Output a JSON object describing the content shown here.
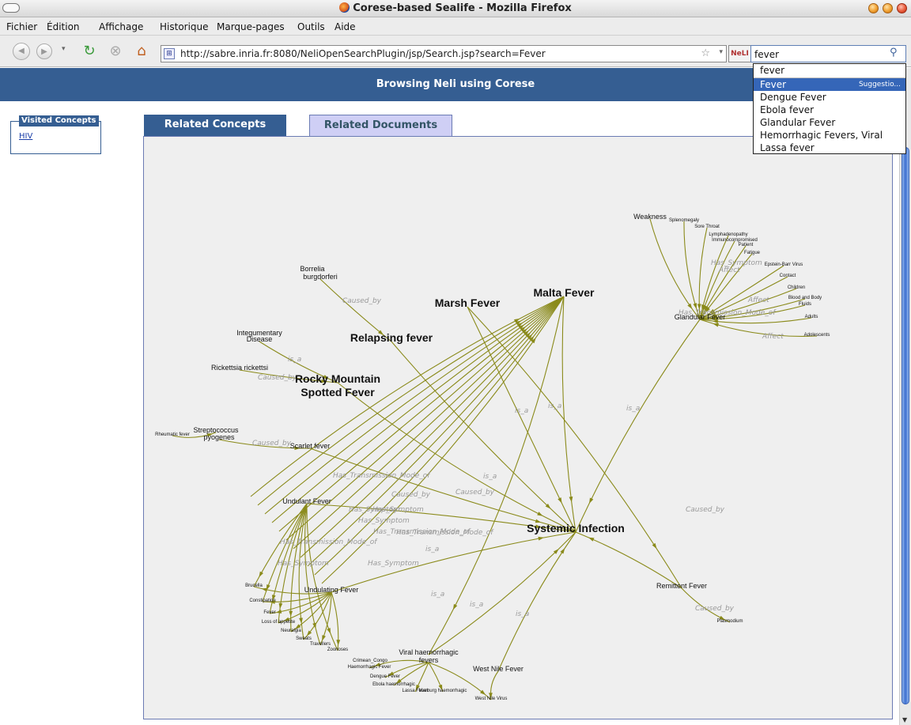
{
  "window": {
    "title": "Corese-based Sealife - Mozilla Firefox"
  },
  "menubar": {
    "items": [
      "Fichier",
      "Édition",
      "Affichage",
      "Historique",
      "Marque-pages",
      "Outils",
      "Aide"
    ]
  },
  "navbar": {
    "url": "http://sabre.inria.fr:8080/NeliOpenSearchPlugin/jsp/Search.jsp?search=Fever",
    "search_value": "fever",
    "search_engine_label": "NeLI"
  },
  "header": {
    "title": "Browsing Neli using Corese"
  },
  "sidebar": {
    "visited_title": "Visited Concepts",
    "visited_links": [
      "HIV"
    ]
  },
  "tabs": [
    {
      "label": "Related Concepts",
      "active": true
    },
    {
      "label": "Related Documents",
      "active": false
    }
  ],
  "suggestions": {
    "typed": "fever",
    "items": [
      "Fever",
      "Dengue Fever",
      "Ebola fever",
      "Glandular Fever",
      "Hemorrhagic Fevers, Viral",
      "Lassa fever"
    ],
    "selected_index": 0,
    "selected_hint": "Suggestio..."
  },
  "graph": {
    "edge_color": "#8a8a1a",
    "nodes": [
      {
        "id": "systemic",
        "label": "Systemic Infection",
        "size": "large"
      },
      {
        "id": "malta",
        "label": "Malta Fever",
        "size": "large"
      },
      {
        "id": "marsh",
        "label": "Marsh Fever",
        "size": "large"
      },
      {
        "id": "relapsing",
        "label": "Relapsing fever",
        "size": "large"
      },
      {
        "id": "rocky",
        "label": "Rocky Mountain",
        "size": "large"
      },
      {
        "id": "spotted",
        "label": "Spotted Fever",
        "size": "large"
      },
      {
        "id": "undulant",
        "label": "Undulant Fever",
        "size": "small"
      },
      {
        "id": "undulating",
        "label": "Undulating Fever",
        "size": "small"
      },
      {
        "id": "scarlet",
        "label": "Scarlet fever",
        "size": "small"
      },
      {
        "id": "borrelia1",
        "label": "Borrelia",
        "size": "small"
      },
      {
        "id": "borrelia2",
        "label": "burgdorferi",
        "size": "small"
      },
      {
        "id": "integ1",
        "label": "Integumentary",
        "size": "small"
      },
      {
        "id": "integ2",
        "label": "Disease",
        "size": "small"
      },
      {
        "id": "rickettsia",
        "label": "Rickettsia rickettsi",
        "size": "small"
      },
      {
        "id": "strep1",
        "label": "Streptococcus",
        "size": "small"
      },
      {
        "id": "strep2",
        "label": "pyogenes",
        "size": "small"
      },
      {
        "id": "rheum",
        "label": "Rheumatic fever",
        "size": "tiny"
      },
      {
        "id": "glandular",
        "label": "Glandular Fever",
        "size": "small"
      },
      {
        "id": "weakness",
        "label": "Weakness",
        "size": "small"
      },
      {
        "id": "remittent",
        "label": "Remittent Fever",
        "size": "small"
      },
      {
        "id": "plasmodium",
        "label": "Plasmodium",
        "size": "tiny"
      },
      {
        "id": "viral1",
        "label": "Viral haemorrhagic",
        "size": "small"
      },
      {
        "id": "viral2",
        "label": "fevers",
        "size": "small"
      },
      {
        "id": "westnile",
        "label": "West Nile Fever",
        "size": "small"
      },
      {
        "id": "westnilevirus",
        "label": "West Nile Virus",
        "size": "tiny"
      },
      {
        "id": "crimean1",
        "label": "Crimean_Congo",
        "size": "tiny"
      },
      {
        "id": "crimean2",
        "label": "Haemorrhagic Fever",
        "size": "tiny"
      },
      {
        "id": "dengue",
        "label": "Dengue Fever",
        "size": "tiny"
      },
      {
        "id": "ebola",
        "label": "Ebola haemorrhagic",
        "size": "tiny"
      },
      {
        "id": "lassa",
        "label": "Lassa Fever",
        "size": "tiny"
      },
      {
        "id": "marburg",
        "label": "Marburg haemorrhagic",
        "size": "tiny"
      },
      {
        "id": "brucella",
        "label": "Brucella",
        "size": "tiny"
      },
      {
        "id": "constipation",
        "label": "Constipation",
        "size": "tiny"
      },
      {
        "id": "fever",
        "label": "Fever",
        "size": "tiny"
      },
      {
        "id": "lossapp",
        "label": "Loss of appetite",
        "size": "tiny"
      },
      {
        "id": "neuralgia",
        "label": "Neuralgia",
        "size": "tiny"
      },
      {
        "id": "sweats",
        "label": "Sweats",
        "size": "tiny"
      },
      {
        "id": "travellers",
        "label": "Travellers",
        "size": "tiny"
      },
      {
        "id": "zoonoses",
        "label": "Zoonoses",
        "size": "tiny"
      },
      {
        "id": "splenomegaly",
        "label": "Splenomegaly",
        "size": "tiny"
      },
      {
        "id": "sorethroat",
        "label": "Sore Throat",
        "size": "tiny"
      },
      {
        "id": "lymph",
        "label": "Lymphadenopathy",
        "size": "tiny"
      },
      {
        "id": "immuno",
        "label": "Immunocompromised",
        "size": "tiny"
      },
      {
        "id": "patient",
        "label": "Patient",
        "size": "tiny"
      },
      {
        "id": "fatigue",
        "label": "Fatigue",
        "size": "tiny"
      },
      {
        "id": "ebv",
        "label": "Epstein-Barr Virus",
        "size": "tiny"
      },
      {
        "id": "contact",
        "label": "Contact",
        "size": "tiny"
      },
      {
        "id": "children",
        "label": "Children",
        "size": "tiny"
      },
      {
        "id": "blood",
        "label": "Blood and Body",
        "size": "tiny"
      },
      {
        "id": "fluids",
        "label": "Fluids",
        "size": "tiny"
      },
      {
        "id": "adults",
        "label": "Adults",
        "size": "tiny"
      },
      {
        "id": "adolescents",
        "label": "Adolescents",
        "size": "tiny"
      }
    ],
    "edge_labels": [
      "Caused_by",
      "Caused_by",
      "Caused_by",
      "Caused_by",
      "Caused_by",
      "Caused_by",
      "is_a",
      "is_a",
      "is_a",
      "is_a",
      "is_a",
      "is_a",
      "is_a",
      "is_a",
      "is_a",
      "Has_Transmission_Mode_of",
      "Has_Transmission_Mode_of",
      "Has_Transmission_Mode_of",
      "Has_Symptom",
      "Has_Symptom",
      "Has_Symptom",
      "Has_Symptom",
      "Has_Transmission_Mode_of",
      "Has_Transmission_Mode_of",
      "Has_Symptom",
      "Affect",
      "Affect",
      "Affect",
      "Has_Symptom",
      "Caused_by"
    ]
  }
}
